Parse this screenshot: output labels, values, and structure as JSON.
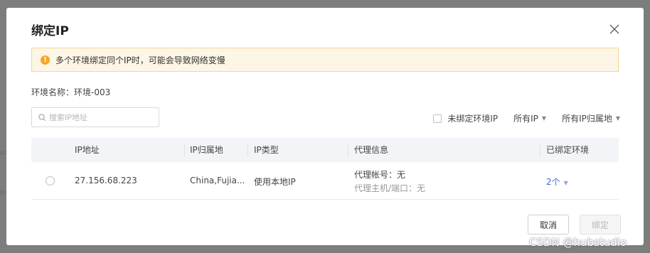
{
  "dialog": {
    "title": "绑定IP",
    "alert": "多个环境绑定同个IP时，可能会导致网络变慢",
    "env_label": "环境名称：",
    "env_name": "环境-003"
  },
  "toolbar": {
    "search_placeholder": "搜索IP地址",
    "unbound_filter_label": "未绑定环境IP",
    "ip_filter_label": "所有IP",
    "location_filter_label": "所有IP归属地"
  },
  "table": {
    "columns": [
      "IP地址",
      "IP归属地",
      "IP类型",
      "代理信息",
      "已绑定环境"
    ],
    "rows": [
      {
        "ip": "27.156.68.223",
        "location": "China,Fujia...",
        "type": "使用本地IP",
        "proxy_account": "代理帐号：无",
        "proxy_host": "代理主机/端口：无",
        "bound_count": "2个"
      }
    ]
  },
  "buttons": {
    "cancel": "取消",
    "bind": "绑定"
  },
  "watermark": "CSDN @hubstudio",
  "colors": {
    "accent": "#3a6fd8",
    "warning": "#f5a623"
  }
}
